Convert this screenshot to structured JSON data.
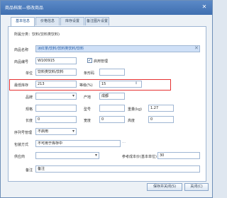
{
  "window": {
    "title": "商品档案—修改商品",
    "close_icon": "close-icon"
  },
  "tabs": [
    {
      "label": "基本信息"
    },
    {
      "label": "价格信息"
    },
    {
      "label": "库存设置"
    },
    {
      "label": "备注图片设置"
    }
  ],
  "form": {
    "note": "所属分类：饮料(饮料类饮料)",
    "goods_name_label": "商品名称",
    "goods_name_value": "冰红茶/饮料/饮料类饮料/饮料",
    "goods_code_label": "商品编号",
    "goods_code_value": "W100915",
    "enable_label": "启用管理",
    "enable_checked": "✓",
    "unit_label": "单位",
    "unit_value": "饮料类饮料/饮料",
    "barcode_label": "条形码",
    "barcode_value": "",
    "min_stock_label": "最低库存",
    "min_stock_value": "213",
    "grade_label": "等级(%)",
    "grade_value": "15",
    "brand_label": "品牌",
    "brand_value": "",
    "origin_label": "产地",
    "origin_value": "成都",
    "spec_label": "规格",
    "spec_value": "",
    "model_label": "型号",
    "model_value": "",
    "weight_label": "重量(kg)",
    "weight_value": "1.27",
    "length_label": "长度",
    "length_value": "0",
    "width_label": "宽度",
    "width_value": "0",
    "height_label": "高度",
    "height_value": "0",
    "serial_label": "序列号管理",
    "serial_value": "不启用",
    "pack_label": "包装方式",
    "pack_value": "不可用于库存中",
    "supplier_label": "供应商",
    "supplier_value": "",
    "cost_label": "参考成本价(基本单位)",
    "cost_value": "30",
    "remark_label": "备注",
    "remark_value": "备注"
  },
  "buttons": {
    "save_close": "保存并关闭(S)",
    "close": "关闭(C)"
  }
}
